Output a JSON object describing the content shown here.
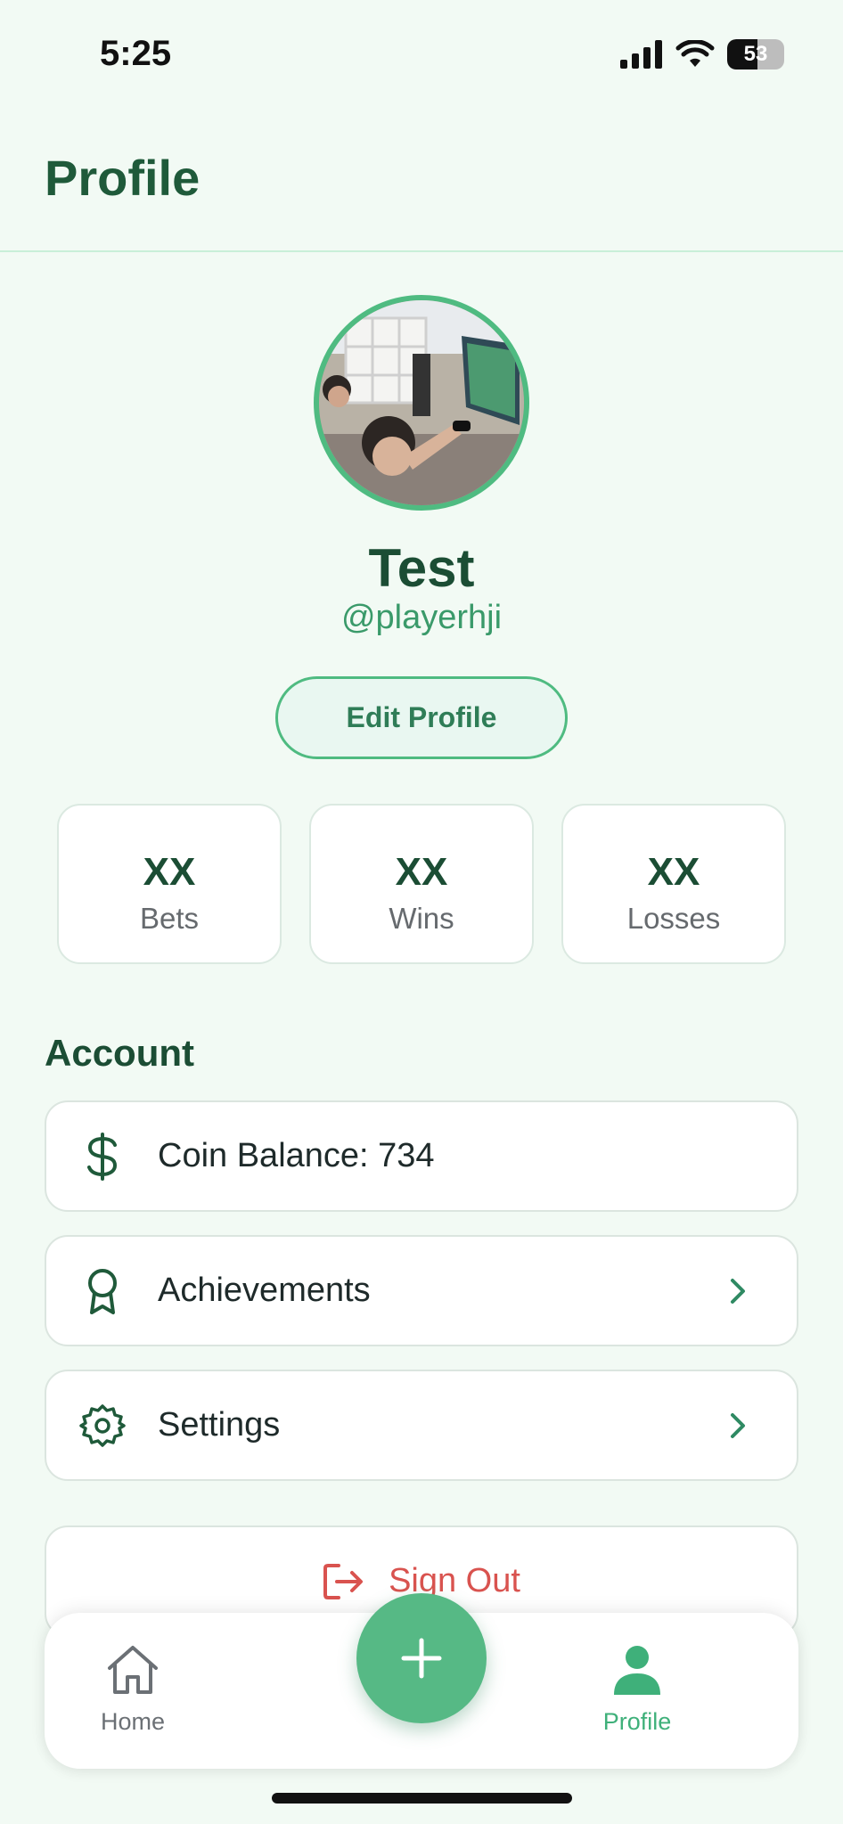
{
  "status_bar": {
    "time": "5:25",
    "battery": "53",
    "battery_level": 0.53
  },
  "header": {
    "title": "Profile"
  },
  "profile": {
    "name": "Test",
    "handle": "@playerhji",
    "edit_label": "Edit Profile"
  },
  "stats": [
    {
      "value": "XX",
      "label": "Bets"
    },
    {
      "value": "XX",
      "label": "Wins"
    },
    {
      "value": "XX",
      "label": "Losses"
    }
  ],
  "account": {
    "title": "Account",
    "items": [
      {
        "label": "Coin Balance: 734",
        "icon": "dollar-icon"
      },
      {
        "label": "Achievements",
        "icon": "award-icon"
      },
      {
        "label": "Settings",
        "icon": "gear-icon"
      }
    ]
  },
  "sign_out": {
    "label": "Sign Out",
    "icon": "logout-icon"
  },
  "tabbar": {
    "home_label": "Home",
    "profile_label": "Profile",
    "add_icon": "plus-icon"
  },
  "colors": {
    "background": "#f2faf4",
    "accent": "#4fbb81",
    "title": "#1b4d34",
    "danger": "#d9534f"
  }
}
